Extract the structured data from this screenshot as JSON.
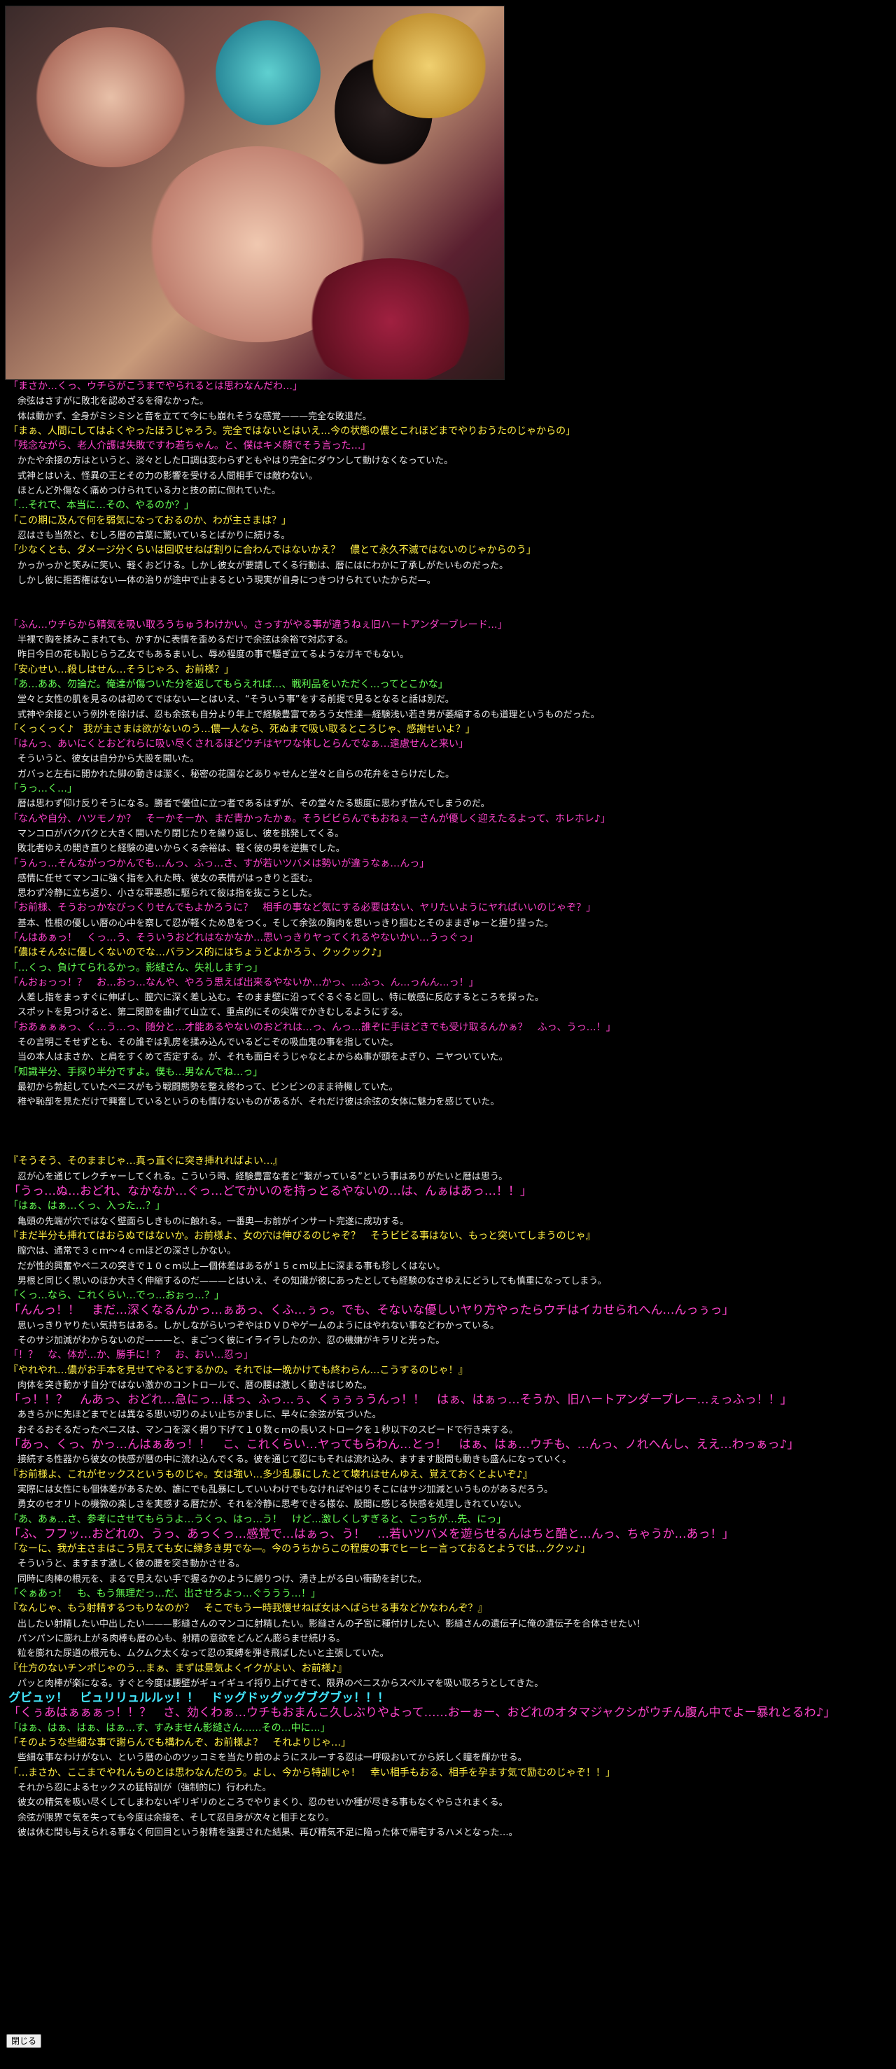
{
  "illustration": {},
  "close_label": "閉じる",
  "lines": [
    {
      "c": "magenta",
      "t": "「まさか…くっ、ウチらがこうまでやられるとは思わなんだわ…」"
    },
    {
      "c": "narr",
      "t": "　余弦はさすがに敗北を認めざるを得なかった。"
    },
    {
      "c": "narr",
      "t": "　体は動かず、全身がミシミシと音を立てて今にも崩れそうな感覚———完全な敗退だ。"
    },
    {
      "c": "yellow",
      "t": "「まぁ、人間にしてはよくやったほうじゃろう。完全ではないとはいえ…今の状態の儂とこれほどまでやりおうたのじゃからの」"
    },
    {
      "c": "magenta",
      "t": "「残念ながら、老人介護は失敗ですわ若ちゃん。と、僕はキメ顔でそう言った…」"
    },
    {
      "c": "narr",
      "t": "　かたや余接の方はというと、淡々とした口調は変わらずともやはり完全にダウンして動けなくなっていた。"
    },
    {
      "c": "narr",
      "t": "　式神とはいえ、怪異の王とその力の影響を受ける人間相手では敵わない。"
    },
    {
      "c": "narr",
      "t": "　ほとんど外傷なく痛めつけられている力と技の前に倒れていた。"
    },
    {
      "c": "green",
      "t": "「…それで、本当に…その、やるのか？」"
    },
    {
      "c": "yellow",
      "t": "「この期に及んで何を弱気になっておるのか、わが主さまは？」"
    },
    {
      "c": "narr",
      "t": "　忍はさも当然と、むしろ暦の言葉に驚いているとばかりに続ける。"
    },
    {
      "c": "yellow",
      "t": "「少なくとも、ダメージ分くらいは回収せねば割りに合わんではないかえ？　儂とて永久不滅ではないのじゃからのう」"
    },
    {
      "c": "narr",
      "t": "　かっかっかと笑みに笑い、軽くおどける。しかし彼女が要請してくる行動は、暦にはにわかに了承しがたいものだった。"
    },
    {
      "c": "narr",
      "t": "　しかし彼に拒否権はない—体の治りが途中で止まるという現実が自身につきつけられていたからだ—。"
    },
    {
      "c": "narr",
      "t": ""
    },
    {
      "c": "narr",
      "t": ""
    },
    {
      "c": "magenta",
      "t": "「ふん…ウチらから精気を吸い取ろうちゅうわけかい。さっすがやる事が違うねぇ旧ハートアンダーブレード…」"
    },
    {
      "c": "narr",
      "t": "　半裸で胸を揉みこまれても、かすかに表情を歪めるだけで余弦は余裕で対応する。"
    },
    {
      "c": "narr",
      "t": "　昨日今日の花も恥じらう乙女でもあるまいし、辱め程度の事で騒ぎ立てるようなガキでもない。"
    },
    {
      "c": "yellow",
      "t": "「安心せい…殺しはせん…そうじゃろ、お前様？」"
    },
    {
      "c": "green",
      "t": "「あ…ああ、勿論だ。俺達が傷ついた分を返してもらえれば…、戦利品をいただく…ってとこかな」"
    },
    {
      "c": "narr",
      "t": "　堂々と女性の肌を見るのは初めてではない—とはいえ、“そういう事”をする前提で見るとなると話は別だ。"
    },
    {
      "c": "narr",
      "t": "　式神や余接という例外を除けば、忍も余弦も自分より年上で経験豊富であろう女性達—経験浅い若き男が萎縮するのも道理というものだった。"
    },
    {
      "c": "yellow",
      "t": "「くっくっく♪　我が主さまは欲がないのう…儂一人なら、死ぬまで吸い取るところじゃ、感謝せいよ？」"
    },
    {
      "c": "magenta",
      "t": "「はんっ、あいにくとおどれらに吸い尽くされるほどウチはヤワな体しとらんでなぁ…遠慮せんと来い」"
    },
    {
      "c": "narr",
      "t": "　そういうと、彼女は自分から大股を開いた。"
    },
    {
      "c": "narr",
      "t": "　ガバっと左右に開かれた脚の動きは潔く、秘密の花園などありゃせんと堂々と自らの花弁をさらけだした。"
    },
    {
      "c": "green",
      "t": "「うっ…く…」"
    },
    {
      "c": "narr",
      "t": "　暦は思わず仰け反りそうになる。勝者で優位に立つ者であるはずが、その堂々たる態度に思わず怯んでしまうのだ。"
    },
    {
      "c": "magenta",
      "t": "「なんや自分、ハツモノか？　そーかそーか、まだ青かったかぁ。そうビビらんでもおねぇーさんが優しく迎えたるよって、ホレホレ♪」"
    },
    {
      "c": "narr",
      "t": "　マンコロがパクパクと大きく開いたり閉じたりを繰り返し、彼を挑発してくる。"
    },
    {
      "c": "narr",
      "t": "　敗北者ゆえの開き直りと経験の違いからくる余裕は、軽く彼の男を逆撫でした。"
    },
    {
      "c": "magenta",
      "t": "「うんっ…そんながっつかんでも…んっ、ふっ…さ、すが若いツバメは勢いが違うなぁ…んっ」"
    },
    {
      "c": "narr",
      "t": "　感情に任せてマンコに強く指を入れた時、彼女の表情がはっきりと歪む。"
    },
    {
      "c": "narr",
      "t": "　思わず冷静に立ち返り、小さな罪悪感に駆られて彼は指を抜こうとした。"
    },
    {
      "c": "magenta",
      "t": "「お前様、そうおっかなびっくりせんでもよかろうに？　相手の事など気にする必要はない、ヤリたいようにヤればいいのじゃぞ？」"
    },
    {
      "c": "narr",
      "t": "　基本、性根の優しい暦の心中を察して忍が軽くため息をつく。そして余弦の胸肉を思いっきり掴むとそのままぎゅーと握り捏った。"
    },
    {
      "c": "magenta",
      "t": "「んはあぁっ！　くっ…う、そういうおどれはなかなか…思いっきりヤってくれるやないかい…うっぐっ」"
    },
    {
      "c": "yellow",
      "t": "「儂はそんなに優しくないのでな…バランス的にはちょうどよかろう、クックック♪」"
    },
    {
      "c": "green",
      "t": "「…くっ、負けてられるかっ。影縫さん、失礼しますっ」"
    },
    {
      "c": "magenta",
      "t": "「んおぉっっ！？　お…おっ…なんや、やろう思えば出来るやないか…かっ、…ふっ、ん…っんん…っ！」"
    },
    {
      "c": "narr",
      "t": "　人差し指をまっすぐに伸ばし、膣穴に深く差し込む。そのまま壁に沿ってぐるぐると回し、特に敏感に反応するところを探った。"
    },
    {
      "c": "narr",
      "t": "　スポットを見つけると、第二関節を曲げて山立て、重点的にその尖端でかきむしるようにする。"
    },
    {
      "c": "magenta",
      "t": "「おあぁぁぁっ、く…う…っ、随分と…才能あるやないのおどれは…っ、んっ…誰ぞに手ほどきでも受け取るんかぁ？　ふっ、うっ…！」"
    },
    {
      "c": "narr",
      "t": "　その言明こそせずとも、その誰ぞは乳房を揉み込んでいるどこぞの吸血鬼の事を指していた。"
    },
    {
      "c": "narr",
      "t": "　当の本人はまさか、と肩をすくめて否定する。が、それも面白そうじゃなとよからぬ事が頭をよぎり、ニヤついていた。"
    },
    {
      "c": "green",
      "t": "「知識半分、手探り半分ですよ。僕も…男なんでね…っ」"
    },
    {
      "c": "narr",
      "t": "　最初から勃起していたペニスがもう戦闘態勢を整え終わって、ビンビンのまま待機していた。"
    },
    {
      "c": "narr",
      "t": "　稚や恥部を見ただけで興奮しているというのも情けないものがあるが、それだけ彼は余弦の女体に魅力を感じていた。"
    },
    {
      "c": "narr",
      "t": ""
    },
    {
      "c": "narr",
      "t": ""
    },
    {
      "c": "narr",
      "t": ""
    },
    {
      "c": "yellow",
      "t": "『そうそう、そのままじゃ…真っ直ぐに突き挿れればよい…』"
    },
    {
      "c": "narr",
      "t": "　忍が心を通じてレクチャーしてくれる。こういう時、経験豊富な者と“繋がっている”という事はありがたいと暦は思う。"
    },
    {
      "c": "magenta",
      "big": true,
      "t": "「うっ…ぬ…おどれ、なかなか…ぐっ…どでかいのを持っとるやないの…は、んぁはあっ…！！」"
    },
    {
      "c": "green",
      "t": "「はぁ、はぁ…くっ、入った…？」"
    },
    {
      "c": "narr",
      "t": "　亀頭の先端が穴ではなく壁面らしきものに触れる。一番奥—お前がインサート完遂に成功する。"
    },
    {
      "c": "yellow",
      "t": "『まだ半分も挿れてはおらぬではないか。お前様よ、女の穴は伸びるのじゃぞ？　そうビビる事はない、もっと突いてしまうのじゃ』"
    },
    {
      "c": "narr",
      "t": "　膣穴は、通常で３ｃｍ～４ｃｍほどの深さしかない。"
    },
    {
      "c": "narr",
      "t": "　だが性的興奮やペニスの突きで１０ｃｍ以上—個体差はあるが１５ｃｍ以上に深まる事も珍しくはない。"
    },
    {
      "c": "narr",
      "t": "　男根と同じく思いのほか大きく伸縮するのだ———とはいえ、その知識が彼にあったとしても経験のなさゆえにどうしても慎重になってしまう。"
    },
    {
      "c": "green",
      "t": "「くっ…なら、これくらい…でっ…おぉっ…？」"
    },
    {
      "c": "magenta",
      "big": true,
      "t": "「んんっ！！　まだ…深くなるんかっ…ぁあっ、くふ…ぅっ。でも、そないな優しいヤり方やったらウチはイカせられへん…んっぅっ」"
    },
    {
      "c": "narr",
      "t": "　思いっきりヤりたい気持ちはある。しかしながらいつぞやはＤＶＤやゲームのようにはやれない事などわかっている。"
    },
    {
      "c": "narr",
      "t": "　そのサジ加減がわからないのだ———と、まごつく彼にイライラしたのか、忍の機嫌がキラリと光った。"
    },
    {
      "c": "magenta",
      "t": "「！？　な、体が…か、勝手に！？　お、おい…忍っ」"
    },
    {
      "c": "yellow",
      "t": "『やれやれ…儂がお手本を見せてやるとするかの。それでは一晩かけても終わらん…こうするのじゃ！』"
    },
    {
      "c": "narr",
      "t": "　肉体を突き動かす自分ではない激かのコントロールで、暦の腰は激しく動きはじめた。"
    },
    {
      "c": "magenta",
      "big": true,
      "t": "「っ！！？　んあっ、おどれ…急にっ…ほっ、ふっ…ぅ、くぅぅぅうんっ！！　はぁ、はぁっ…そうか、旧ハートアンダーブレー…ぇっふっ！！」"
    },
    {
      "c": "narr",
      "t": "　あきらかに先ほどまでとは異なる思い切りのよい止ちかましに、早々に余弦が気づいた。"
    },
    {
      "c": "narr",
      "t": "　おそるおそるだったペニスは、マンコを深く掘り下げて１０数ｃｍの長いストロークを１秒以下のスピードで行き来する。"
    },
    {
      "c": "magenta",
      "big": true,
      "t": "「あっ、くっ、かっ…んはぁあっ！！　こ、これくらい…ヤってもらわん…とっ！　はぁ、はぁ…ウチも、…んっ、ノれへんし、ええ…わっぁっ♪」"
    },
    {
      "c": "narr",
      "t": "　接続する性器から彼女の快感が暦の中に流れ込んでくる。彼を通じて忍にもそれは流れ込み、ますます股間も動きも盛んになっていく。"
    },
    {
      "c": "yellow",
      "t": "『お前様よ、これがセックスというものじゃ。女は強い…多少乱暴にしたとて壊れはせんゆえ、覚えておくとよいぞ♪』"
    },
    {
      "c": "narr",
      "t": "　実際には女性にも個体差があるため、誰にでも乱暴にしていいわけでもなければやはりそこにはサジ加減というものがあるだろう。"
    },
    {
      "c": "narr",
      "t": "　勇女のセオリトの機微の楽しさを実感する暦だが、それを冷静に思考できる様な、股間に感じる快感を処理しきれていない。"
    },
    {
      "c": "green",
      "t": "「あ、あぁ…さ、参考にさせてもらうよ…うくっ、はっ…う！　けど…激しくしすぎると、こっちが…先、にっ」"
    },
    {
      "c": "magenta",
      "big": true,
      "t": "「ふ、フフッ…おどれの、うっ、あっくっ…感覚で…はぁっ、う！　…若いツバメを遊らせるんはちと酷と…んっ、ちゃうか…あっ！」"
    },
    {
      "c": "yellow",
      "t": "「なーに、我が主さまはこう見えても女に縁多き男でな―。今のうちからこの程度の事でヒーヒー言っておるとようでは…ククッ♪」"
    },
    {
      "c": "narr",
      "t": "　そういうと、ますます激しく彼の腰を突き動かさせる。"
    },
    {
      "c": "narr",
      "t": "　同時に肉棒の根元を、まるで見えない手で握るかのように締りつけ、湧き上がる白い衝動を封じた。"
    },
    {
      "c": "green",
      "t": "「ぐぁあっ！　も、もう無理だっ…だ、出させろよっ…ぐううう…！」"
    },
    {
      "c": "yellow",
      "t": "『なんじゃ、もう射精するつもりなのか？　そこでもう一時我慢せねば女はへばらせる事などかなわんぞ？』"
    },
    {
      "c": "narr",
      "t": "　出したい射精したい中出したい———影縫さんのマンコに射精したい。影縫さんの子宮に種付けしたい、影縫さんの遺伝子に俺の遺伝子を合体させたい！"
    },
    {
      "c": "narr",
      "t": "　パンパンに膨れ上がる肉棒も暦の心も、射精の意欲をどんどん膨らませ続ける。"
    },
    {
      "c": "narr",
      "t": "　粒を膨れた尿道の根元も、ムクムク太くなって忍の束縛を弾き飛ばしたいと主張していた。"
    },
    {
      "c": "yellow",
      "t": "『仕方のないチンポじゃのう…まぁ、まずは景気よくイクがよい、お前様♪』"
    },
    {
      "c": "narr",
      "t": "　パッと肉棒が楽になる。すぐと今度は腰壁がギュイギュイ捋り上げてきて、限界のペニスからスペルマを吸い取ろうとしてきた。"
    },
    {
      "c": "cyan",
      "big": true,
      "t": "グビュッ！　ビュリリュルルッ！！　ドッグドッグッグブグブッ！！！"
    },
    {
      "c": "magenta",
      "big": true,
      "t": "「くぅあはぁぁぁっ！！？　さ、効くわぁ…ウチもおまんこ久しぶりやよって……おーぉー、おどれのオタマジャクシがウチん腹ん中でよー暴れとるわ♪」"
    },
    {
      "c": "green",
      "t": "「はぁ、はぁ、はぁ、はぁ…す、すみません影縫さん……その…中に…」"
    },
    {
      "c": "yellow",
      "t": "「そのような些細な事で謝らんでも構わんぞ、お前様よ？　それよりじゃ…」"
    },
    {
      "c": "narr",
      "t": "　些細な事なわけがない、という暦の心のツッコミを当たり前のようにスルーする忍は一呼吸おいてから妖しく瞳を輝かせる。"
    },
    {
      "c": "yellow",
      "t": "「…まさか、ここまでやれんものとは思わなんだのう。よし、今から特訓じゃ！　幸い相手もおる、相手を孕ます気で励むのじゃぞ！！」"
    },
    {
      "c": "narr",
      "t": "　それから忍によるセックスの猛特訓が（強制的に）行われた。"
    },
    {
      "c": "narr",
      "t": "　彼女の精気を吸い尽くしてしまわないギリギリのところでやりまくり、忍のせいか種が尽きる事もなくやらされまくる。"
    },
    {
      "c": "narr",
      "t": "　余弦が限界で気を失っても今度は余接を、そして忍自身が次々と相手となり。"
    },
    {
      "c": "narr",
      "t": "　彼は休む間も与えられる事なく何回目という射精を強要された結果、再び精気不足に陥った体で帰宅するハメとなった…。"
    }
  ]
}
